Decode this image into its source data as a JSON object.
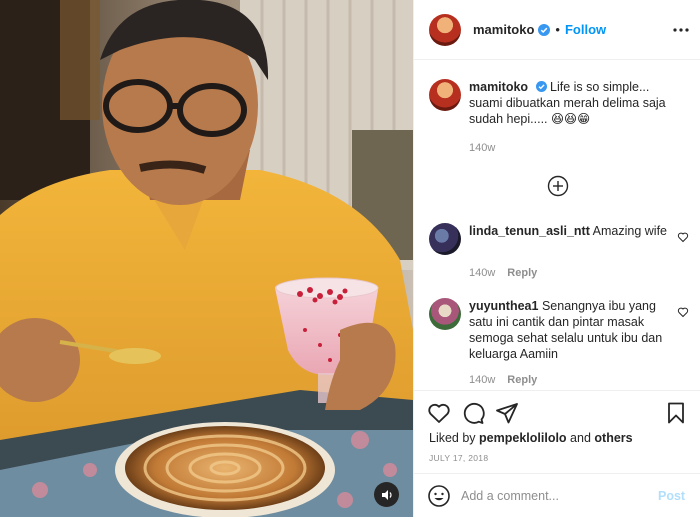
{
  "post": {
    "username": "mamitoko",
    "follow_label": "Follow",
    "separator": "•"
  },
  "caption": {
    "username": "mamitoko",
    "text": "Life is so simple... suami dibuatkan merah delima saja sudah hepi..... 😆😆😁",
    "time": "140w"
  },
  "comments": [
    {
      "username": "linda_tenun_asli_ntt",
      "text": "Amazing wife",
      "time": "140w",
      "reply_label": "Reply"
    },
    {
      "username": "yuyunthea1",
      "text": "Senangnya ibu yang satu ini cantik dan pintar masak semoga sehat selalu untuk ibu dan keluarga Aamiin",
      "time": "140w",
      "reply_label": "Reply"
    }
  ],
  "likes": {
    "prefix": "Liked by",
    "user": "pempeklolilolo",
    "connector": "and",
    "others": "others"
  },
  "date": "JULY 17, 2018",
  "compose": {
    "placeholder": "Add a comment...",
    "post_label": "Post"
  },
  "icons": [
    "verified-badge-icon",
    "more-options-icon",
    "load-more-plus-icon",
    "heart-icon",
    "comment-icon",
    "share-icon",
    "save-bookmark-icon",
    "emoji-icon",
    "sound-icon"
  ],
  "colors": {
    "accent": "#0095f6",
    "post_disabled": "#b2dffc",
    "muted": "#8e8e8e",
    "border": "#efefef"
  }
}
